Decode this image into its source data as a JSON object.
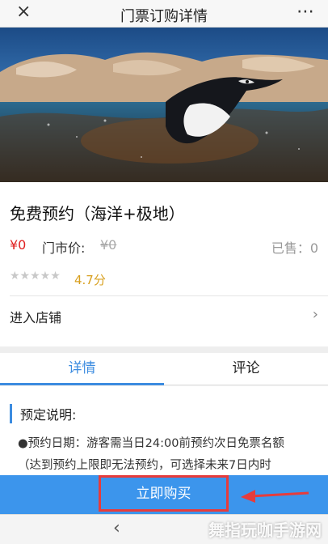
{
  "header": {
    "title": "门票订购详情",
    "close_icon": "×",
    "more_icon": "⋯"
  },
  "product": {
    "title": "免费预约（海洋+极地）",
    "price": "¥0",
    "market_price_label": "门市价:",
    "market_price": "¥0",
    "sold": "已售：0",
    "stars": "★★★★★",
    "rating": "4.7分",
    "store_label": "进入店铺",
    "store_chevron": "›"
  },
  "tabs": {
    "details": "详情",
    "reviews": "评论"
  },
  "content": {
    "notice_title": "预定说明:",
    "line1": "●预约日期：游客需当日24:00前预约次日免票名额",
    "line2": "（达到预约上限即无法预约，可选择未来7日内时"
  },
  "buy_button": "立即购买",
  "bottom": {
    "back_chevron": "‹"
  },
  "watermark": "舞指玩咖手游网",
  "colors": {
    "accent": "#3c8ce0",
    "price": "#e02020",
    "rating": "#d8a020",
    "highlight": "#e63c3c"
  }
}
